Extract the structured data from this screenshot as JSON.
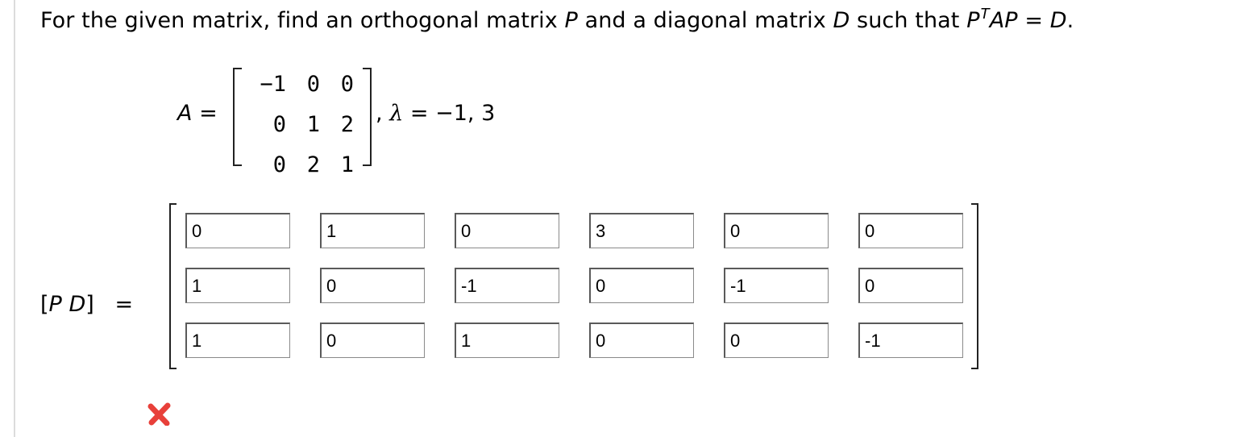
{
  "question": {
    "intro": "For the given matrix, find an orthogonal matrix",
    "P": "P",
    "and": "and a diagonal matrix",
    "D": "D",
    "such_that": "such that",
    "eq_P": "P",
    "eq_T": "T",
    "eq_AP": "AP",
    "eq_sign": "=",
    "eq_D": "D",
    "period": "."
  },
  "matrix_A": {
    "label": "A",
    "equals": "=",
    "rows": [
      [
        "−1",
        "0",
        "0"
      ],
      [
        "0",
        "1",
        "2"
      ],
      [
        "0",
        "2",
        "1"
      ]
    ]
  },
  "eigen": {
    "comma": ",",
    "symbol": "λ",
    "text": "= −1, 3"
  },
  "pd": {
    "label_open": "[",
    "P": "P",
    "D": "D",
    "label_close": "]",
    "equals": "=",
    "cells": [
      [
        "0",
        "1",
        "0",
        "3",
        "0",
        "0"
      ],
      [
        "1",
        "0",
        "-1",
        "0",
        "-1",
        "0"
      ],
      [
        "1",
        "0",
        "1",
        "0",
        "0",
        "-1"
      ]
    ]
  },
  "result": {
    "icon": "x-icon",
    "color": "#e8403a",
    "status": "incorrect"
  }
}
